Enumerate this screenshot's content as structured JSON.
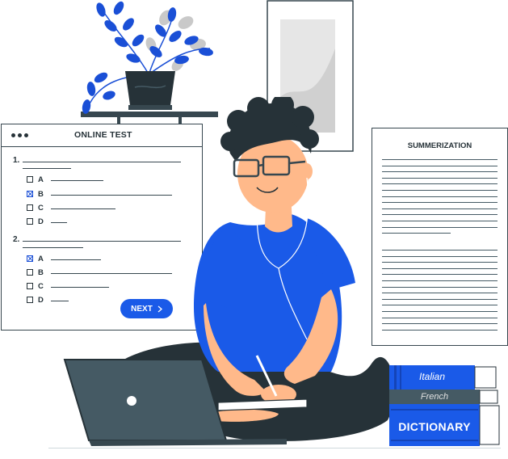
{
  "online_test": {
    "title": "ONLINE TEST",
    "questions": [
      {
        "number": "1.",
        "options": [
          {
            "letter": "A",
            "checked": false
          },
          {
            "letter": "B",
            "checked": true
          },
          {
            "letter": "C",
            "checked": false
          },
          {
            "letter": "D",
            "checked": false
          }
        ]
      },
      {
        "number": "2.",
        "options": [
          {
            "letter": "A",
            "checked": true
          },
          {
            "letter": "B",
            "checked": false
          },
          {
            "letter": "C",
            "checked": false
          },
          {
            "letter": "D",
            "checked": false
          }
        ]
      }
    ],
    "next_label": "NEXT",
    "next_icon": "chevron-right-icon"
  },
  "summary": {
    "title": "SUMMERIZATION"
  },
  "books": {
    "italian": "Italian",
    "french": "French",
    "dictionary": "DICTIONARY"
  },
  "colors": {
    "accent_blue": "#1a5ae8",
    "dark": "#263238",
    "skin": "#ffb98a",
    "hair": "#263238",
    "laptop": "#455a64"
  }
}
